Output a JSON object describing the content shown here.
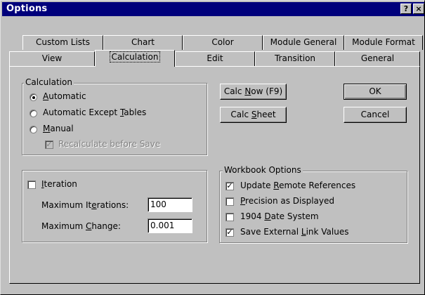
{
  "window": {
    "title": "Options",
    "help_glyph": "?",
    "close_glyph": "×"
  },
  "tabs_back": [
    "Custom Lists",
    "Chart",
    "Color",
    "Module General",
    "Module Format"
  ],
  "tabs_front": [
    "View",
    "Calculation",
    "Edit",
    "Transition",
    "General"
  ],
  "selected_tab": "Calculation",
  "calculation": {
    "legend": "Calculation",
    "automatic": "Automatic",
    "automatic_except_tables": "Automatic Except Tables",
    "manual": "Manual",
    "selected": "Automatic",
    "recalc_before_save": "Recalculate before Save",
    "recalc_checked": true,
    "recalc_enabled": false
  },
  "iteration": {
    "label": "Iteration",
    "checked": false,
    "max_iterations_label": "Maximum Iterations:",
    "max_iterations_value": "100",
    "max_change_label": "Maximum Change:",
    "max_change_value": "0.001"
  },
  "buttons": {
    "calc_now": "Calc Now (F9)",
    "calc_sheet": "Calc Sheet",
    "ok": "OK",
    "cancel": "Cancel"
  },
  "workbook": {
    "legend": "Workbook Options",
    "update_remote": {
      "label": "Update Remote References",
      "checked": true
    },
    "precision": {
      "label": "Precision as Displayed",
      "checked": false
    },
    "date1904": {
      "label": "1904 Date System",
      "checked": false
    },
    "save_external": {
      "label": "Save External Link Values",
      "checked": true
    }
  }
}
